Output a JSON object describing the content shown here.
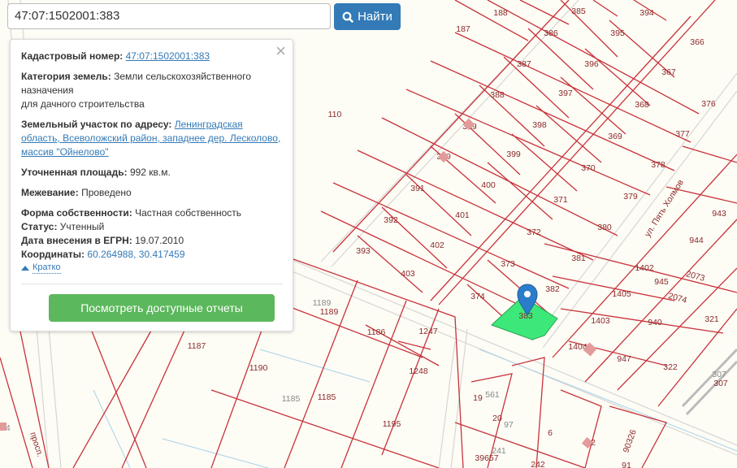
{
  "search": {
    "value": "47:07:1502001:383",
    "button_label": "Найти"
  },
  "panel": {
    "cadastral_label": "Кадастровый номер:",
    "cadastral_value": "47:07:1502001:383",
    "category_label": "Категория земель:",
    "category_value": "Земли сельскохозяйственного назначения",
    "usage_value": "для дачного строительства",
    "address_label": "Земельный участок по адресу:",
    "address_value": "Ленинградская область, Всеволожский район, западнее дер. Лесколово, массив \"Ойнелово\"",
    "area_label": "Уточненная площадь:",
    "area_value": "992 кв.м.",
    "survey_label": "Межевание:",
    "survey_value": "Проведено",
    "ownership_label": "Форма собственности:",
    "ownership_value": "Частная собственность",
    "status_label": "Статус:",
    "status_value": "Учтенный",
    "date_label": "Дата внесения в ЕГРН:",
    "date_value": "19.07.2010",
    "coords_label": "Координаты:",
    "coords_value": "60.264988, 30.417459",
    "toggle_label": "Кратко",
    "reports_button": "Посмотреть доступные отчеты"
  },
  "map": {
    "street_1": "ул. Пять Холмов",
    "street_2": "просп.",
    "selected_parcel": "383",
    "parcels": [
      "188",
      "385",
      "394",
      "187",
      "386",
      "395",
      "366",
      "387",
      "396",
      "367",
      "388",
      "397",
      "376",
      "368",
      "389",
      "398",
      "377",
      "110",
      "369",
      "390",
      "399",
      "378",
      "370",
      "391",
      "400",
      "371",
      "379",
      "392",
      "401",
      "372",
      "380",
      "943",
      "393",
      "402",
      "373",
      "381",
      "944",
      "403",
      "1402",
      "2073",
      "374",
      "382",
      "945",
      "1405",
      "2074",
      "1189",
      "1189",
      "1403",
      "940",
      "321",
      "1186",
      "1247",
      "1187",
      "1404",
      "947",
      "322",
      "1190",
      "1248",
      "307",
      "307",
      "1185",
      "1185",
      "19",
      "561",
      "1195",
      "20",
      "97",
      "6",
      "22",
      "90326",
      "39657",
      "241",
      "242",
      "91",
      "374"
    ]
  },
  "colors": {
    "parcel_line": "#c8323a",
    "selected_fill": "#3de87a",
    "accent": "#337ab7",
    "reports": "#5cb85c"
  }
}
